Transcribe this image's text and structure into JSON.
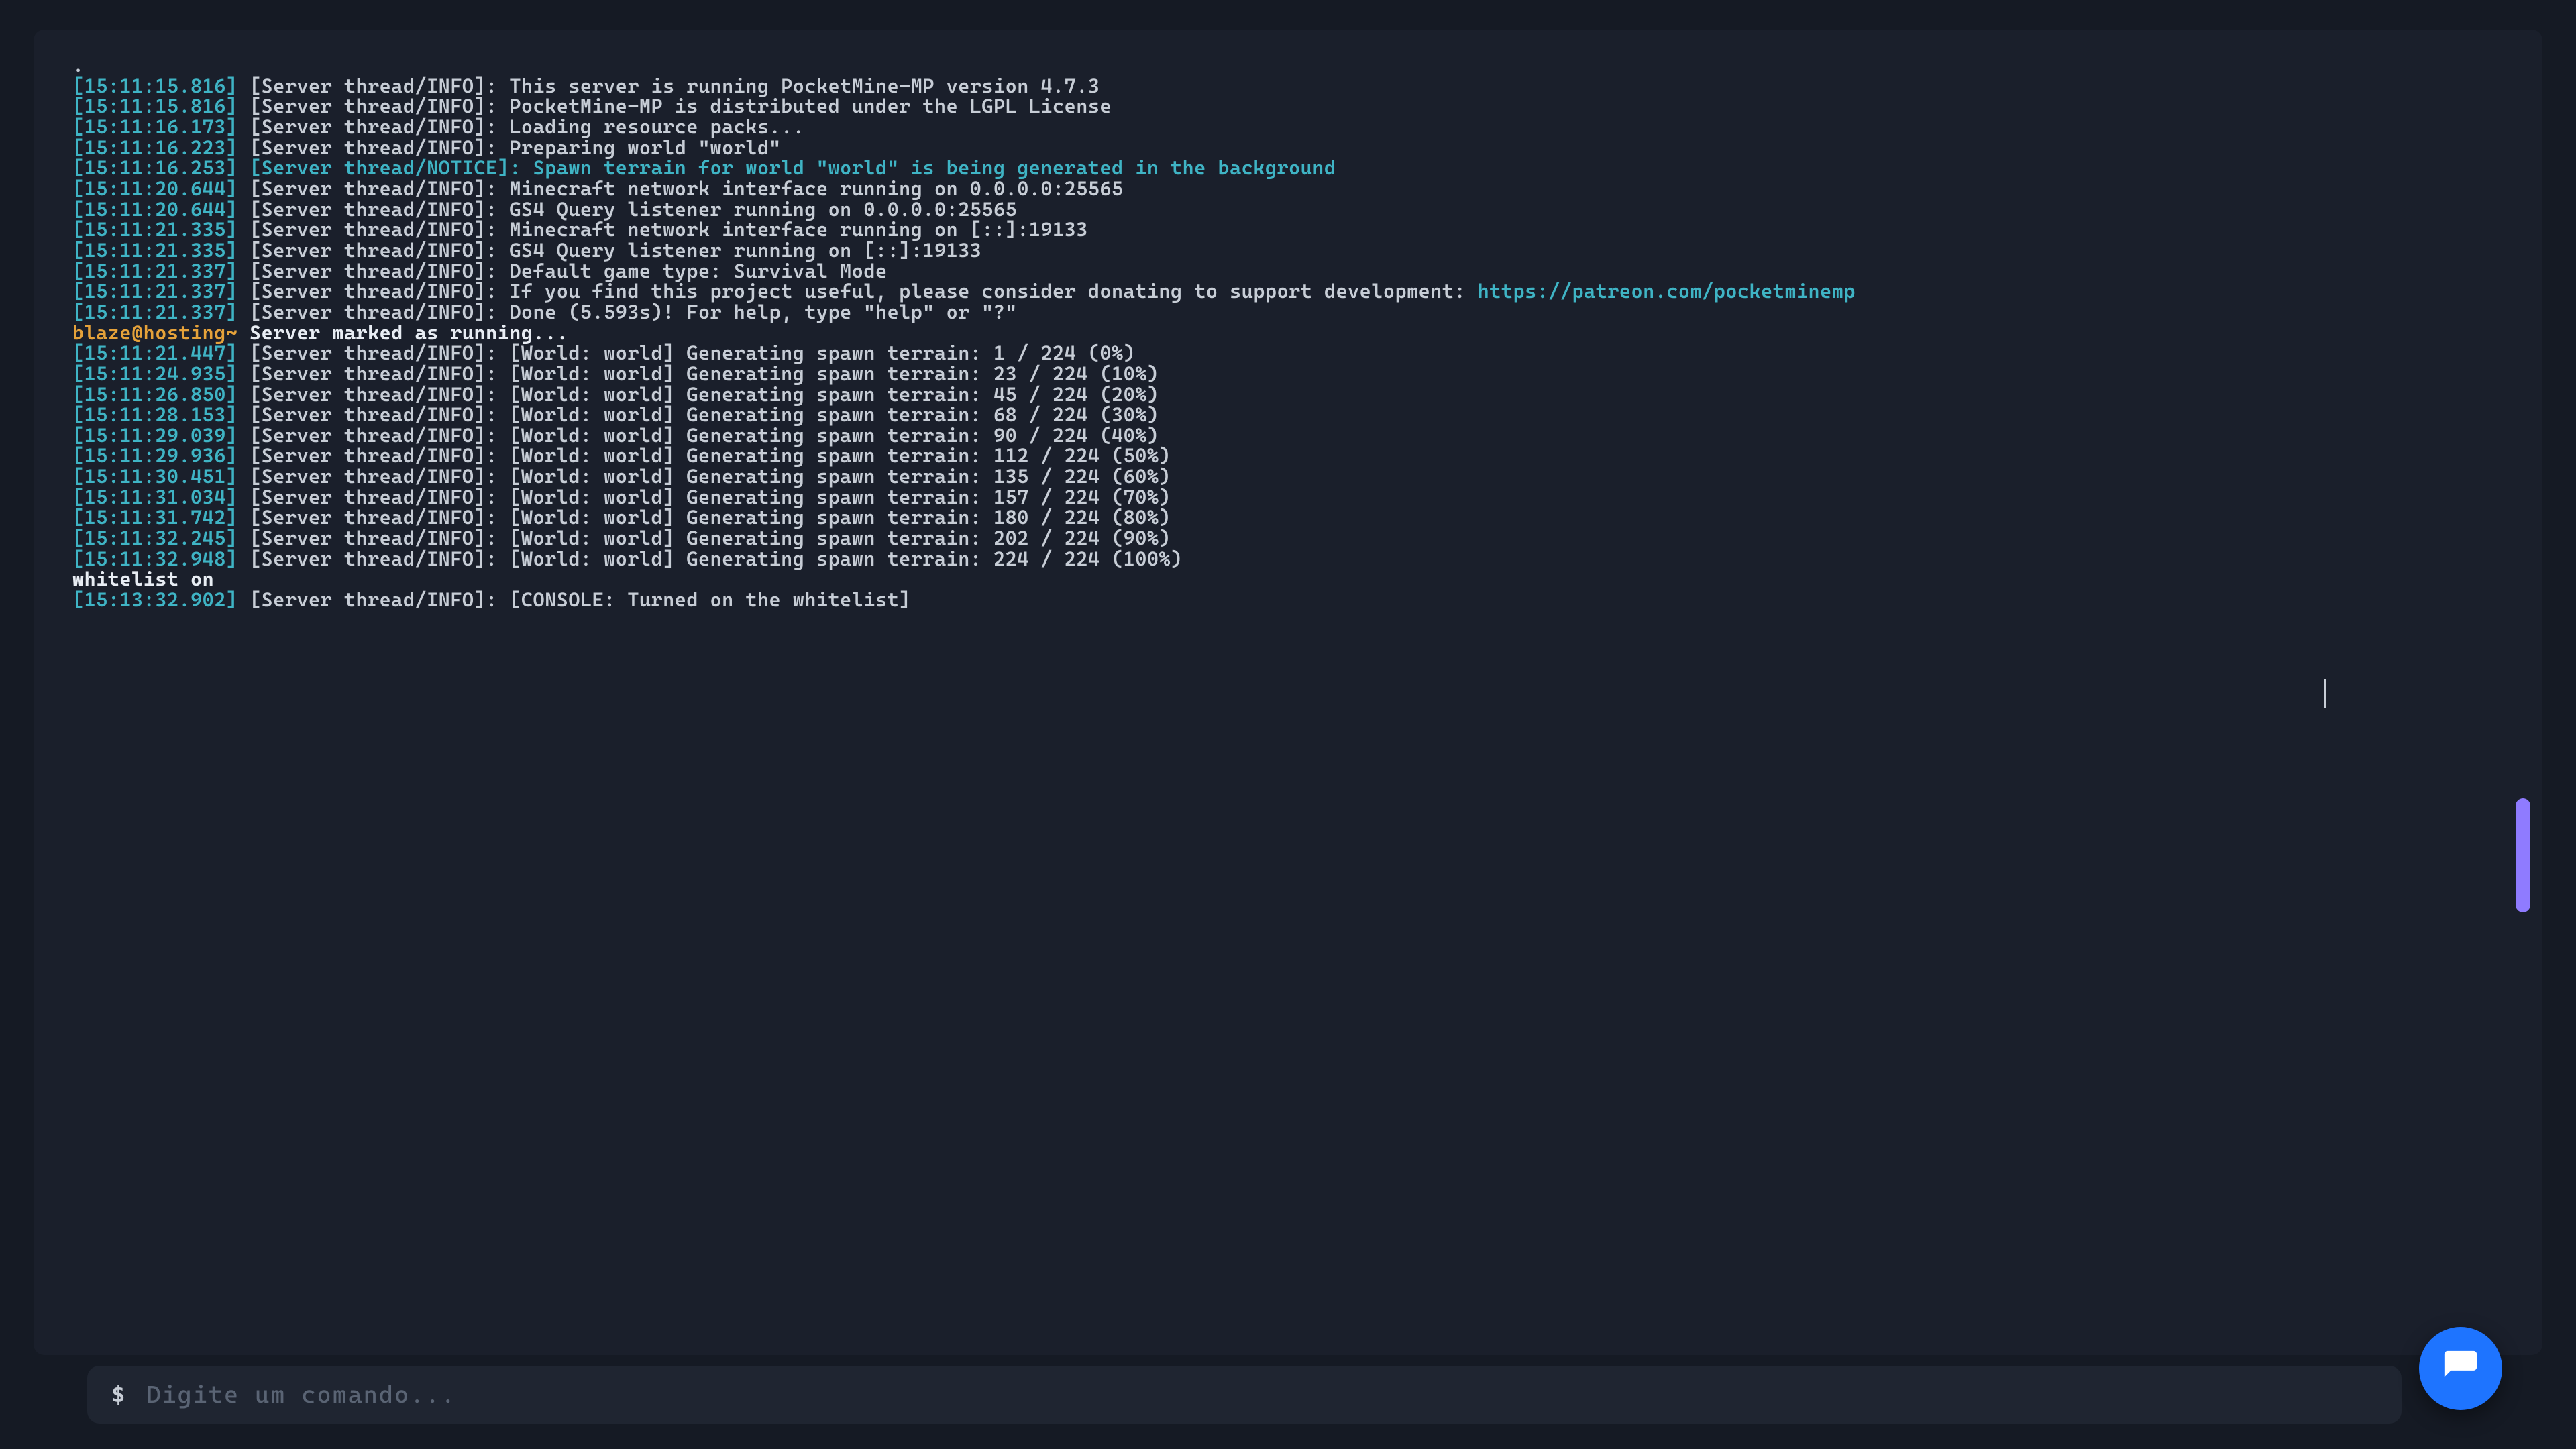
{
  "console": {
    "lines": [
      {
        "type": "plain",
        "text": "."
      },
      {
        "type": "log",
        "ts": "[15:11:15.816]",
        "tag": "[Server thread/INFO]:",
        "msg": "This server is running PocketMine-MP version 4.7.3"
      },
      {
        "type": "log",
        "ts": "[15:11:15.816]",
        "tag": "[Server thread/INFO]:",
        "msg": "PocketMine-MP is distributed under the LGPL License"
      },
      {
        "type": "log",
        "ts": "[15:11:16.173]",
        "tag": "[Server thread/INFO]:",
        "msg": "Loading resource packs..."
      },
      {
        "type": "log",
        "ts": "[15:11:16.223]",
        "tag": "[Server thread/INFO]:",
        "msg": "Preparing world \"world\""
      },
      {
        "type": "notice",
        "ts": "[15:11:16.253]",
        "tag": "[Server thread/NOTICE]:",
        "msg": "Spawn terrain for world \"world\" is being generated in the background"
      },
      {
        "type": "log",
        "ts": "[15:11:20.644]",
        "tag": "[Server thread/INFO]:",
        "msg": "Minecraft network interface running on 0.0.0.0:25565"
      },
      {
        "type": "log",
        "ts": "[15:11:20.644]",
        "tag": "[Server thread/INFO]:",
        "msg": "GS4 Query listener running on 0.0.0.0:25565"
      },
      {
        "type": "log",
        "ts": "[15:11:21.335]",
        "tag": "[Server thread/INFO]:",
        "msg": "Minecraft network interface running on [::]:19133"
      },
      {
        "type": "log",
        "ts": "[15:11:21.335]",
        "tag": "[Server thread/INFO]:",
        "msg": "GS4 Query listener running on [::]:19133"
      },
      {
        "type": "log",
        "ts": "[15:11:21.337]",
        "tag": "[Server thread/INFO]:",
        "msg": "Default game type: Survival Mode"
      },
      {
        "type": "log_url",
        "ts": "[15:11:21.337]",
        "tag": "[Server thread/INFO]:",
        "msg": "If you find this project useful, please consider donating to support development: ",
        "url": "https://patreon.com/pocketminemp"
      },
      {
        "type": "log",
        "ts": "[15:11:21.337]",
        "tag": "[Server thread/INFO]:",
        "msg": "Done (5.593s)! For help, type \"help\" or \"?\""
      },
      {
        "type": "prompt",
        "prefix": "blaze@hosting~",
        "msg": "Server marked as running..."
      },
      {
        "type": "log",
        "ts": "[15:11:21.447]",
        "tag": "[Server thread/INFO]:",
        "msg": "[World: world] Generating spawn terrain: 1 / 224 (0%)"
      },
      {
        "type": "log",
        "ts": "[15:11:24.935]",
        "tag": "[Server thread/INFO]:",
        "msg": "[World: world] Generating spawn terrain: 23 / 224 (10%)"
      },
      {
        "type": "log",
        "ts": "[15:11:26.850]",
        "tag": "[Server thread/INFO]:",
        "msg": "[World: world] Generating spawn terrain: 45 / 224 (20%)"
      },
      {
        "type": "log",
        "ts": "[15:11:28.153]",
        "tag": "[Server thread/INFO]:",
        "msg": "[World: world] Generating spawn terrain: 68 / 224 (30%)"
      },
      {
        "type": "log",
        "ts": "[15:11:29.039]",
        "tag": "[Server thread/INFO]:",
        "msg": "[World: world] Generating spawn terrain: 90 / 224 (40%)"
      },
      {
        "type": "log",
        "ts": "[15:11:29.936]",
        "tag": "[Server thread/INFO]:",
        "msg": "[World: world] Generating spawn terrain: 112 / 224 (50%)"
      },
      {
        "type": "log",
        "ts": "[15:11:30.451]",
        "tag": "[Server thread/INFO]:",
        "msg": "[World: world] Generating spawn terrain: 135 / 224 (60%)"
      },
      {
        "type": "log",
        "ts": "[15:11:31.034]",
        "tag": "[Server thread/INFO]:",
        "msg": "[World: world] Generating spawn terrain: 157 / 224 (70%)"
      },
      {
        "type": "log",
        "ts": "[15:11:31.742]",
        "tag": "[Server thread/INFO]:",
        "msg": "[World: world] Generating spawn terrain: 180 / 224 (80%)"
      },
      {
        "type": "log",
        "ts": "[15:11:32.245]",
        "tag": "[Server thread/INFO]:",
        "msg": "[World: world] Generating spawn terrain: 202 / 224 (90%)"
      },
      {
        "type": "log",
        "ts": "[15:11:32.948]",
        "tag": "[Server thread/INFO]:",
        "msg": "[World: world] Generating spawn terrain: 224 / 224 (100%)"
      },
      {
        "type": "bold",
        "msg": "whitelist on"
      },
      {
        "type": "log",
        "ts": "[15:13:32.902]",
        "tag": "[Server thread/INFO]:",
        "msg": "[CONSOLE: Turned on the whitelist]"
      }
    ]
  },
  "input": {
    "symbol": "$",
    "placeholder": "Digite um comando...",
    "value": ""
  },
  "chat_fab": {
    "icon": "chat-bubble-icon"
  },
  "colors": {
    "timestamp": "#3fb4c5",
    "notice": "#3fb4c5",
    "prompt_prefix": "#e5a23a",
    "text": "#c7cdd6",
    "bg_panel": "#1a1f2b",
    "bg_input": "#1f2531",
    "scrollbar": "#8f7bff",
    "fab": "#1e74ff"
  }
}
